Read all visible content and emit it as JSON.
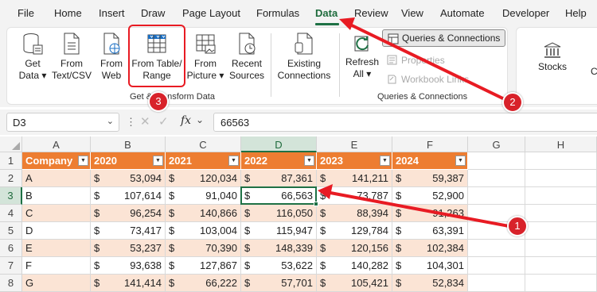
{
  "menu": {
    "tabs": [
      "File",
      "Home",
      "Insert",
      "Draw",
      "Page Layout",
      "Formulas",
      "Data",
      "Review",
      "View",
      "Automate",
      "Developer",
      "Help"
    ],
    "active_tab": "Data"
  },
  "ribbon": {
    "get_data": [
      "Get",
      "Data ▾"
    ],
    "from_text_csv": [
      "From",
      "Text/CSV"
    ],
    "from_web": [
      "From",
      "Web"
    ],
    "from_table_range": [
      "From Table/",
      "Range"
    ],
    "from_picture": [
      "From",
      "Picture ▾"
    ],
    "recent_sources": [
      "Recent",
      "Sources"
    ],
    "existing_connections": [
      "Existing",
      "Connections"
    ],
    "group_get_transform": "Get & Transform Data",
    "refresh_all": [
      "Refresh",
      "All ▾"
    ],
    "queries_connections_button": "Queries & Connections",
    "properties": "Properties",
    "workbook_links": "Workbook Links",
    "group_queries_connections": "Queries & Connections",
    "stocks": "Stocks",
    "cut_off_label": "C"
  },
  "formula_bar": {
    "name_box": "D3",
    "fx": "fx",
    "value": "66563"
  },
  "sheet": {
    "columns": [
      "A",
      "B",
      "C",
      "D",
      "E",
      "F",
      "G",
      "H"
    ],
    "selected_column": "D",
    "selected_row": "3",
    "rows": [
      "1",
      "2",
      "3",
      "4",
      "5",
      "6",
      "7",
      "8"
    ],
    "currency": "$",
    "header": [
      "Company",
      "2020",
      "2021",
      "2022",
      "2023",
      "2024"
    ],
    "data": [
      [
        "A",
        "53,094",
        "120,034",
        "87,361",
        "141,211",
        "59,387"
      ],
      [
        "B",
        "107,614",
        "91,040",
        "66,563",
        "73,787",
        "52,900"
      ],
      [
        "C",
        "96,254",
        "140,866",
        "116,050",
        "88,394",
        "91,263"
      ],
      [
        "D",
        "73,417",
        "103,004",
        "115,947",
        "129,784",
        "63,391"
      ],
      [
        "E",
        "53,237",
        "70,390",
        "148,339",
        "120,156",
        "102,384"
      ],
      [
        "F",
        "93,638",
        "127,867",
        "53,622",
        "140,282",
        "104,301"
      ],
      [
        "G",
        "141,414",
        "66,222",
        "57,701",
        "105,421",
        "52,834"
      ]
    ]
  },
  "annotations": {
    "badges": [
      "1",
      "2",
      "3"
    ],
    "accent_color": "#d8222a",
    "table_header_color": "#ed7d31",
    "band_color": "#fbe4d5"
  }
}
